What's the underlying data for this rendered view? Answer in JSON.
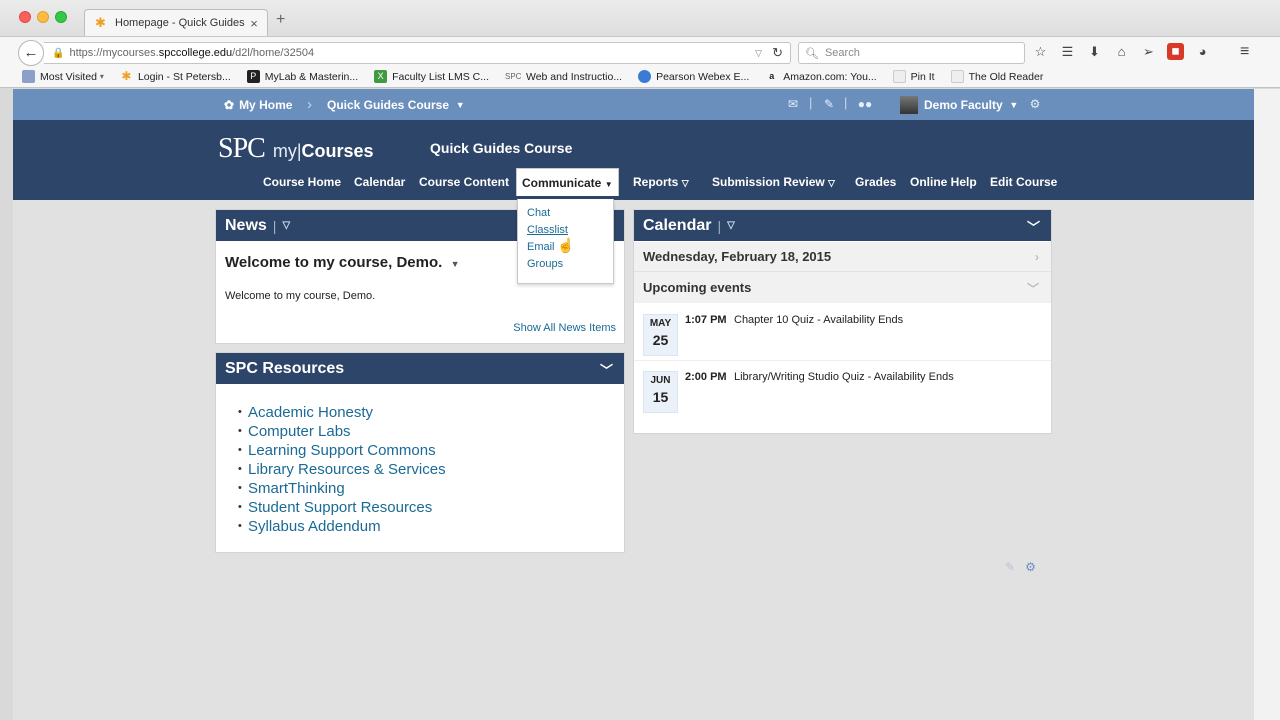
{
  "browser": {
    "tab_title": "Homepage - Quick Guides ...",
    "url_prefix": "https://mycourses.",
    "url_domain": "spccollege.edu",
    "url_path": "/d2l/home/32504",
    "search_placeholder": "Search",
    "bookmarks": [
      {
        "label": "Most Visited",
        "icon": "folder-icon",
        "color": "#8aa0c8"
      },
      {
        "label": "Login - St Petersb...",
        "icon": "asterisk-icon",
        "color": "#f0a020"
      },
      {
        "label": "MyLab & Masterin...",
        "icon": "p-icon",
        "color": "#222222"
      },
      {
        "label": "Faculty List LMS C...",
        "icon": "x-icon",
        "color": "#3f9b3f"
      },
      {
        "label": "Web and Instructio...",
        "icon": "spc-icon",
        "color": "#8a8a8a"
      },
      {
        "label": "Pearson Webex E...",
        "icon": "globe-icon",
        "color": "#3a7bd5"
      },
      {
        "label": "Amazon.com: You...",
        "icon": "amazon-icon",
        "color": "#222222"
      },
      {
        "label": "Pin It",
        "icon": "blank-page-icon",
        "color": "#e8e8e8"
      },
      {
        "label": "The Old Reader",
        "icon": "blank-page-icon",
        "color": "#e8e8e8"
      }
    ]
  },
  "minibar": {
    "home": "My Home",
    "course": "Quick Guides Course",
    "user": "Demo Faculty"
  },
  "header": {
    "logo_spc": "SPC",
    "logo_my": "my|",
    "logo_courses": "Courses",
    "course_title": "Quick Guides Course"
  },
  "course_nav": [
    "Course Home",
    "Calendar",
    "Course Content",
    "Communicate",
    "Reports",
    "Submission Review",
    "Grades",
    "Online Help",
    "Edit Course"
  ],
  "communicate_menu": [
    "Chat",
    "Classlist",
    "Email",
    "Groups"
  ],
  "news": {
    "title": "News",
    "item_title": "Welcome to my course, Demo.",
    "item_body": "Welcome to my course, Demo.",
    "show_all": "Show All News Items"
  },
  "resources": {
    "title": "SPC Resources",
    "items": [
      "Academic Honesty",
      "Computer Labs",
      "Learning Support Commons",
      "Library Resources & Services",
      "SmartThinking",
      "Student Support Resources",
      "Syllabus Addendum"
    ]
  },
  "calendar": {
    "title": "Calendar",
    "current_date": "Wednesday, February 18, 2015",
    "upcoming_label": "Upcoming events",
    "events": [
      {
        "month": "MAY",
        "day": "25",
        "time": "1:07 PM",
        "title": "Chapter 10 Quiz - Availability Ends"
      },
      {
        "month": "JUN",
        "day": "15",
        "time": "2:00 PM",
        "title": "Library/Writing Studio Quiz - Availability Ends"
      }
    ]
  },
  "colors": {
    "navy": "#2d4568",
    "minibar": "#6a8fbd",
    "link": "#1a6a96"
  }
}
